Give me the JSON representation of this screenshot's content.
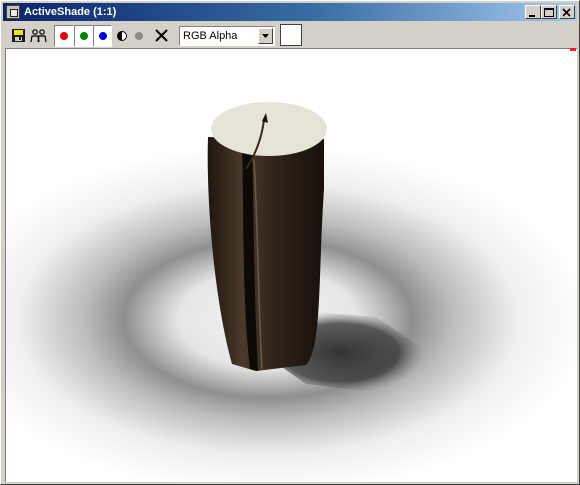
{
  "window": {
    "title": "ActiveShade (1:1)"
  },
  "titlebar_buttons": [
    "minimize-icon",
    "maximize-icon",
    "close-icon"
  ],
  "toolbar": {
    "buttons": [
      "save-image-icon",
      "clone-window-icon",
      "red-channel-icon",
      "green-channel-icon",
      "blue-channel-icon",
      "alpha-channel-icon",
      "monochrome-icon",
      "clear-icon"
    ],
    "channel_colors": {
      "red": "#e00000",
      "green": "#008000",
      "blue": "#0000e0"
    },
    "channel_select": {
      "value": "RGB Alpha"
    },
    "color_swatch": "#ffffff"
  },
  "viewport": {
    "content": "rendered-scene"
  }
}
